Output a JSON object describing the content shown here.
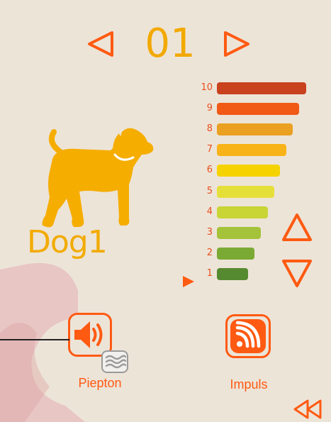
{
  "colors": {
    "background": "#ede4d8",
    "accent": "#ff5a12",
    "dog": "#f5ad00",
    "channel_number": "#f2a900",
    "level_numbers": "#e8501a",
    "decor": "#e6bcbc"
  },
  "channel": {
    "number": "01",
    "prev_icon": "triangle-left-icon",
    "next_icon": "triangle-right-icon"
  },
  "dog": {
    "name": "Dog1",
    "icon": "dog-icon"
  },
  "levels": {
    "selected": 1,
    "items": [
      {
        "label": "10",
        "color": "#c8421e",
        "length": 1.0
      },
      {
        "label": "9",
        "color": "#f05a14",
        "length": 0.92
      },
      {
        "label": "8",
        "color": "#eaa020",
        "length": 0.85
      },
      {
        "label": "7",
        "color": "#f8b318",
        "length": 0.78
      },
      {
        "label": "6",
        "color": "#f5d300",
        "length": 0.71
      },
      {
        "label": "5",
        "color": "#e5df3a",
        "length": 0.64
      },
      {
        "label": "4",
        "color": "#c9d435",
        "length": 0.57
      },
      {
        "label": "3",
        "color": "#a4c33a",
        "length": 0.49
      },
      {
        "label": "2",
        "color": "#7aaa34",
        "length": 0.42
      },
      {
        "label": "1",
        "color": "#568a30",
        "length": 0.35
      }
    ],
    "up_icon": "triangle-up-icon",
    "down_icon": "triangle-down-icon"
  },
  "modes": {
    "tone": {
      "label": "Piepton",
      "icon": "speaker-icon",
      "badge_icon": "vibration-icon"
    },
    "impulse": {
      "label": "Impuls",
      "icon": "signal-waves-icon"
    }
  },
  "navigation": {
    "back_icon": "double-chevron-left-icon"
  }
}
